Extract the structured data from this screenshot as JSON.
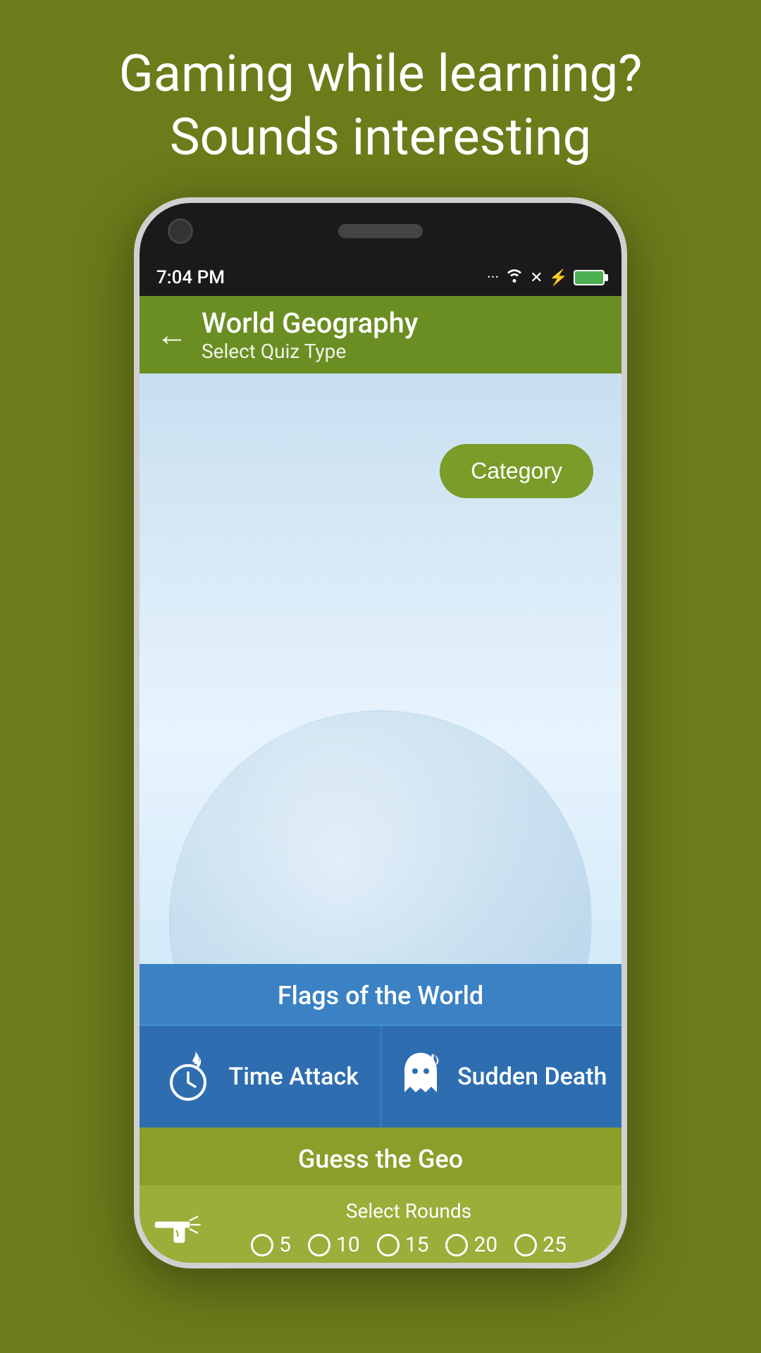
{
  "tagline": {
    "line1": "Gaming while learning?",
    "line2": "Sounds interesting"
  },
  "status_bar": {
    "time": "7:04 PM",
    "dots": "...",
    "wifi": "wifi",
    "battery": "100%"
  },
  "app_bar": {
    "title": "World Geography",
    "subtitle": "Select Quiz Type",
    "back_label": "←"
  },
  "category_button": {
    "label": "Category"
  },
  "flags_card": {
    "title": "Flags of the World",
    "quiz_types": [
      {
        "id": "time-attack",
        "label": "Time Attack"
      },
      {
        "id": "sudden-death",
        "label": "Sudden Death"
      }
    ]
  },
  "geo_card": {
    "title": "Guess the Geo",
    "select_rounds_label": "Select Rounds",
    "rounds": [
      5,
      10,
      15,
      20,
      25
    ]
  }
}
